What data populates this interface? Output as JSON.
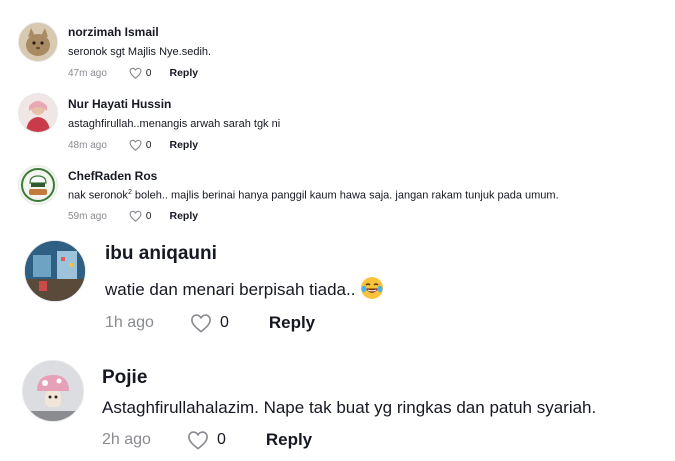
{
  "comments": [
    {
      "author": "norzimah Ismail",
      "text": "seronok sgt Majlis Nye.sedih.",
      "time": "47m ago",
      "likes": "0",
      "reply": "Reply",
      "avatar_icon": "cat-avatar-icon",
      "avatar_color": "#b9a68a"
    },
    {
      "author": "Nur Hayati Hussin",
      "text": "astaghfirullah..menangis arwah sarah tgk ni",
      "time": "48m ago",
      "likes": "0",
      "reply": "Reply",
      "avatar_icon": "person-avatar-icon",
      "avatar_color": "#e7c9cc"
    },
    {
      "author": "ChefRaden Ros",
      "text_prefix": "nak seronok",
      "text_sup": "2",
      "text_suffix": " boleh.. majlis berinai hanya panggil kaum hawa saja. jangan rakam tunjuk pada umum.",
      "time": "59m ago",
      "likes": "0",
      "reply": "Reply",
      "avatar_icon": "chef-logo-avatar-icon",
      "avatar_color": "#e9efe2"
    },
    {
      "author": "ibu aniqauni",
      "text": "watie dan menari berpisah tiada..",
      "emoji": "laughing-tears-emoji",
      "time": "1h ago",
      "likes": "0",
      "reply": "Reply",
      "avatar_icon": "blue-scene-avatar-icon",
      "avatar_color": "#3d6a8a"
    },
    {
      "author": "Pojie",
      "text": "Astaghfirullahalazim. Nape tak buat yg ringkas dan patuh syariah.",
      "time": "2h ago",
      "likes": "0",
      "reply": "Reply",
      "avatar_icon": "mushroom-avatar-icon",
      "avatar_color": "#d9dadc"
    }
  ],
  "colors": {
    "text": "#161823",
    "muted": "#8a8b91",
    "emoji_yellow": "#f8c33b"
  }
}
